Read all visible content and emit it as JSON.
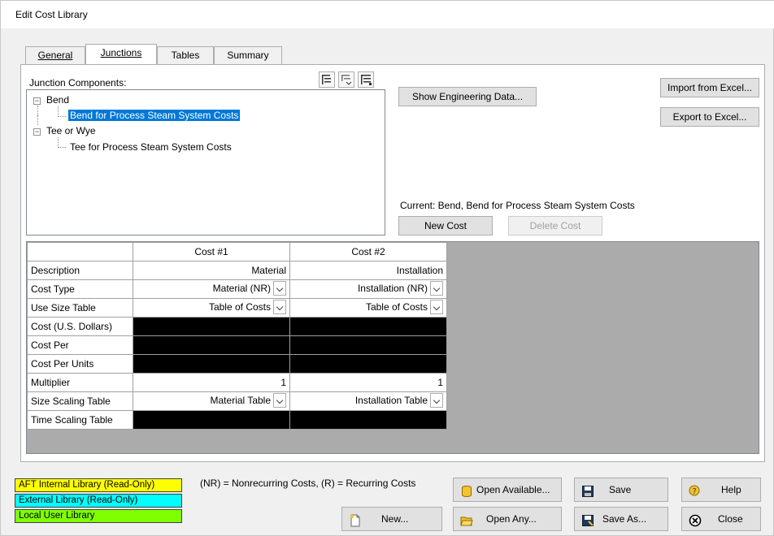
{
  "window": {
    "title": "Edit Cost Library"
  },
  "tabs": [
    {
      "label": "General",
      "active": false
    },
    {
      "label": "Junctions",
      "active": true
    },
    {
      "label": "Tables",
      "active": false
    },
    {
      "label": "Summary",
      "active": false
    }
  ],
  "junctions": {
    "components_label": "Junction Components:",
    "tree": [
      {
        "label": "Bend",
        "expanded": true,
        "children": [
          {
            "label": "Bend for Process Steam System Costs",
            "selected": true
          }
        ]
      },
      {
        "label": "Tee or Wye",
        "expanded": true,
        "children": [
          {
            "label": "Tee for Process Steam System Costs",
            "selected": false
          }
        ]
      }
    ],
    "show_engineering_label": "Show Engineering Data...",
    "import_label": "Import from Excel...",
    "export_label": "Export to Excel...",
    "current_text": "Current: Bend, Bend for Process Steam System Costs",
    "new_cost_label": "New Cost",
    "delete_cost_label": "Delete Cost"
  },
  "grid": {
    "columns": [
      "Cost #1",
      "Cost #2"
    ],
    "rows": [
      {
        "label": "Description",
        "cells": [
          "Material",
          "Installation"
        ],
        "dropdown": false
      },
      {
        "label": "Cost Type",
        "cells": [
          "Material (NR)",
          "Installation (NR)"
        ],
        "dropdown": true
      },
      {
        "label": "Use Size Table",
        "cells": [
          "Table of Costs",
          "Table of Costs"
        ],
        "dropdown": true
      },
      {
        "label": "Cost (U.S. Dollars)",
        "cells": [
          "",
          ""
        ],
        "black": true
      },
      {
        "label": "Cost Per",
        "cells": [
          "",
          ""
        ],
        "black": true
      },
      {
        "label": "Cost Per Units",
        "cells": [
          "",
          ""
        ],
        "black": true
      },
      {
        "label": "Multiplier",
        "cells": [
          "1",
          "1"
        ],
        "dropdown": false
      },
      {
        "label": "Size Scaling Table",
        "cells": [
          "Material Table",
          "Installation Table"
        ],
        "dropdown": true
      },
      {
        "label": "Time Scaling Table",
        "cells": [
          "",
          ""
        ],
        "black": true
      }
    ]
  },
  "legend": {
    "items": [
      {
        "label": "AFT Internal Library (Read-Only)",
        "color": "#ffff00"
      },
      {
        "label": "External Library (Read-Only)",
        "color": "#00ffff"
      },
      {
        "label": "Local User Library",
        "color": "#7fff00"
      }
    ],
    "note": "(NR) = Nonrecurring Costs, (R) = Recurring Costs"
  },
  "footer": {
    "new_label": "New...",
    "open_available_label": "Open Available...",
    "open_any_label": "Open Any...",
    "save_label": "Save",
    "save_as_label": "Save As...",
    "help_label": "Help",
    "close_label": "Close"
  }
}
